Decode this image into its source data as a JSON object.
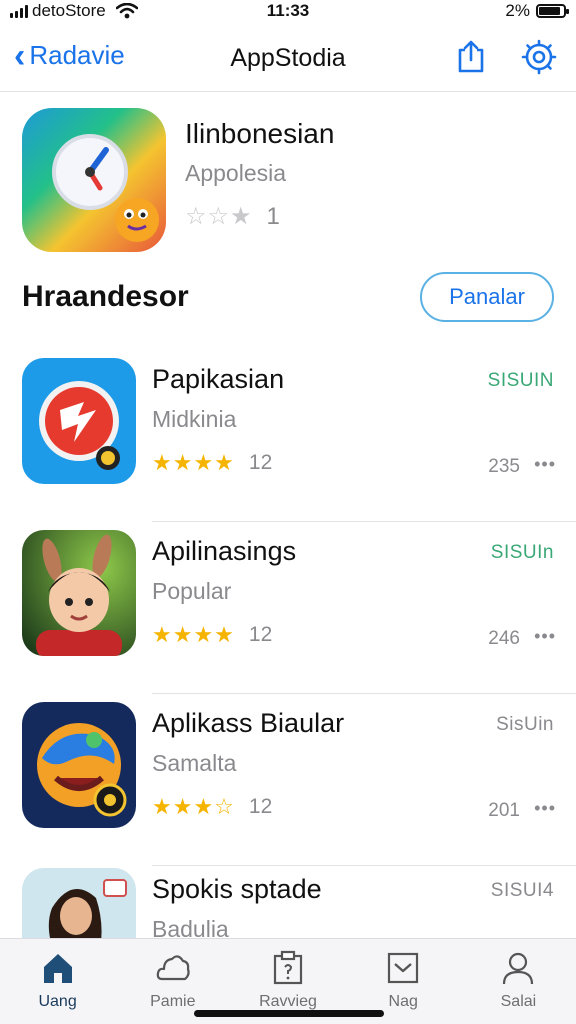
{
  "status_bar": {
    "carrier": "detoStore",
    "time": "11:33",
    "battery": "2%"
  },
  "nav": {
    "back_label": "Radavie",
    "title": "AppStodia"
  },
  "hero": {
    "title": "Ilinbonesian",
    "subtitle": "Appolesia",
    "rating_count": "1",
    "stars": "☆☆★"
  },
  "section": {
    "title": "Hraandesor",
    "button_label": "Panalar"
  },
  "apps": [
    {
      "title": "Papikasian",
      "subtitle": "Midkinia",
      "stars": "★★★★",
      "count": "12",
      "tag": "SISUIN",
      "number": "235",
      "more": "•••"
    },
    {
      "title": "Apilinasings",
      "subtitle": "Popular",
      "stars": "★★★★",
      "count": "12",
      "tag": "SISUIn",
      "number": "246",
      "more": "•••"
    },
    {
      "title": "Aplikass Biaular",
      "subtitle": "Samalta",
      "stars": "★★★☆",
      "count": "12",
      "tag": "SisUin",
      "number": "201",
      "more": "•••"
    },
    {
      "title": "Spokis sptade",
      "subtitle": "Badulia",
      "stars": "",
      "count": "",
      "tag": "SISUI4",
      "number": "",
      "more": ""
    }
  ],
  "tag_colors": [
    "#3aa876",
    "#3aa876",
    "#8a8a8e",
    "#8a8a8e"
  ],
  "tabs": [
    {
      "label": "Uang",
      "icon": "home-icon"
    },
    {
      "label": "Pamie",
      "icon": "cloud-icon"
    },
    {
      "label": "Ravvieg",
      "icon": "clipboard-icon"
    },
    {
      "label": "Nag",
      "icon": "inbox-icon"
    },
    {
      "label": "Salai",
      "icon": "person-icon"
    }
  ],
  "colors": {
    "accent": "#1a73e8",
    "star": "#f5b400",
    "tag_green": "#3aa876"
  }
}
